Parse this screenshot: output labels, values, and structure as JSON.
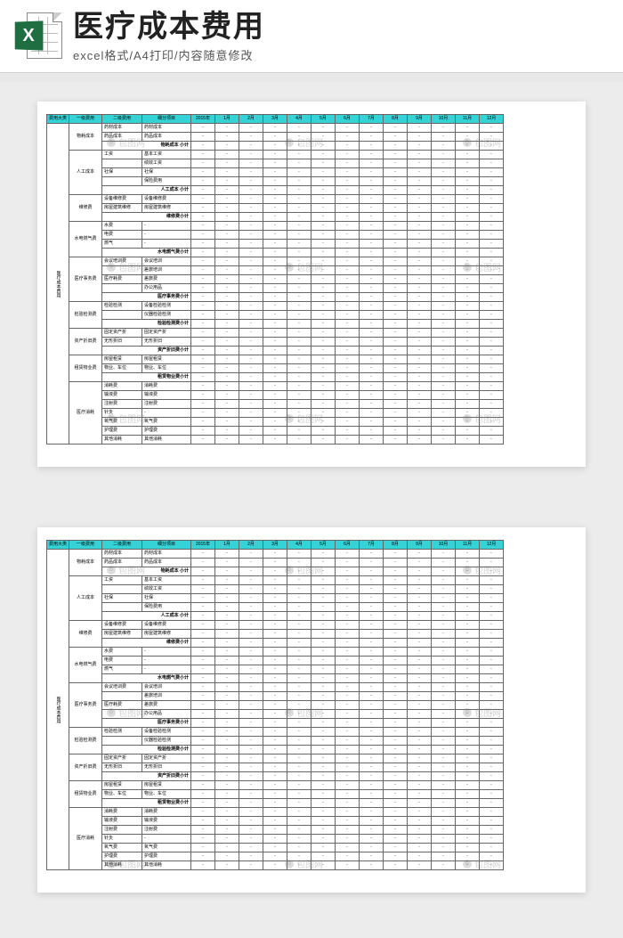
{
  "header": {
    "title": "医疗成本费用",
    "subtitle": "excel格式/A4打印/内容随意修改",
    "logo_letter": "X"
  },
  "watermark": "包图网",
  "columns": [
    "费用大类",
    "一级费用",
    "二级费用",
    "细分项目",
    "2015年",
    "1月",
    "2月",
    "3月",
    "4月",
    "5月",
    "6月",
    "7月",
    "8月",
    "9月",
    "10月",
    "11月",
    "12月"
  ],
  "big_category": "医疗成本费用",
  "groups": [
    {
      "name": "物耗成本",
      "rows": [
        {
          "l2": "药材成本",
          "detail": "药材成本"
        },
        {
          "l2": "药品成本",
          "detail": "药品成本"
        }
      ],
      "subtotal": "物耗成本 小计"
    },
    {
      "name": "人工成本",
      "rows": [
        {
          "l2": "工资",
          "detail": "基本工资"
        },
        {
          "l2": "",
          "detail": "绩效工资"
        },
        {
          "l2": "社保",
          "detail": "社保"
        },
        {
          "l2": "",
          "detail": "保险费用"
        }
      ],
      "subtotal": "人工成本 小计"
    },
    {
      "name": "维修费",
      "rows": [
        {
          "l2": "设备维修费",
          "detail": "设备维修费"
        },
        {
          "l2": "房屋建筑维修",
          "detail": "房屋建筑维修"
        }
      ],
      "subtotal": "维修费小计"
    },
    {
      "name": "水电燃气费",
      "rows": [
        {
          "l2": "水费",
          "detail": "-"
        },
        {
          "l2": "电费",
          "detail": "-"
        },
        {
          "l2": "燃气",
          "detail": "-"
        }
      ],
      "subtotal": "水电燃气费小计"
    },
    {
      "name": "医疗事务费",
      "rows": [
        {
          "l2": "会议培训费",
          "detail": "会议培训"
        },
        {
          "l2": "",
          "detail": "差旅培训"
        },
        {
          "l2": "医疗耗费",
          "detail": "差旅费"
        },
        {
          "l2": "",
          "detail": "办公用品"
        }
      ],
      "subtotal": "医疗事务费小计"
    },
    {
      "name": "检验检测费",
      "rows": [
        {
          "l2": "检验检测",
          "detail": "设备检验检测"
        },
        {
          "l2": "",
          "detail": "仪器检验检测"
        }
      ],
      "subtotal": "检验检测费小计"
    },
    {
      "name": "资产折旧费",
      "rows": [
        {
          "l2": "固定资产折",
          "detail": "固定资产折"
        },
        {
          "l2": "无形折旧",
          "detail": "无形折旧"
        }
      ],
      "subtotal": "资产折旧费小计"
    },
    {
      "name": "租赁物业费",
      "rows": [
        {
          "l2": "房屋租赁",
          "detail": "房屋租赁"
        },
        {
          "l2": "物业、车位",
          "detail": "物业、车位"
        }
      ],
      "subtotal": "租赁物业费小计"
    },
    {
      "name": "医疗消耗",
      "rows": [
        {
          "l2": "消耗费",
          "detail": "消耗费"
        },
        {
          "l2": "输液费",
          "detail": "输液费"
        },
        {
          "l2": "注射费",
          "detail": "注射费"
        },
        {
          "l2": "针灸",
          "detail": "-"
        },
        {
          "l2": "氧气费",
          "detail": "氧气费"
        },
        {
          "l2": "护理费",
          "detail": "护理费"
        },
        {
          "l2": "其他消耗",
          "detail": "其他消耗"
        }
      ],
      "subtotal": ""
    }
  ]
}
